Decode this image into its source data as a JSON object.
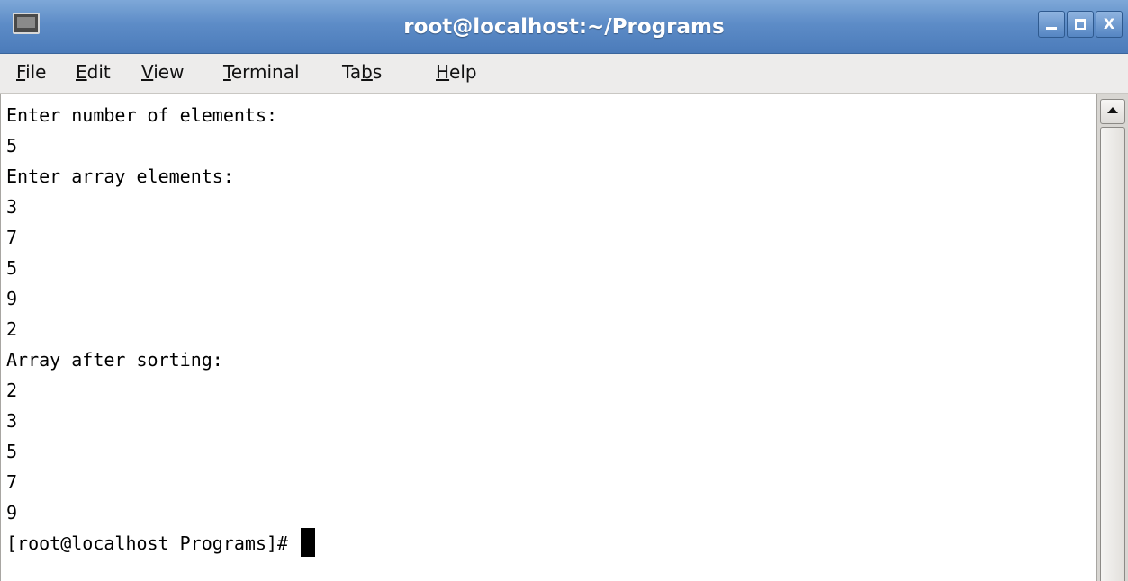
{
  "window": {
    "title": "root@localhost:~/Programs",
    "icon": "terminal-icon",
    "controls": {
      "minimize_icon": "minimize-icon",
      "maximize_icon": "maximize-icon",
      "close_icon": "close-icon",
      "close_label": "X"
    }
  },
  "menubar": {
    "items": [
      {
        "key": "F",
        "rest": "ile"
      },
      {
        "pre": "",
        "key": "E",
        "rest": "dit"
      },
      {
        "pre": "",
        "key": "V",
        "rest": "iew"
      },
      {
        "pre": "",
        "key": "T",
        "rest": "erminal"
      },
      {
        "pre": "Ta",
        "key": "b",
        "rest": "s"
      },
      {
        "pre": "",
        "key": "H",
        "rest": "elp"
      }
    ]
  },
  "terminal": {
    "lines": [
      "Enter number of elements:",
      "5",
      "Enter array elements:",
      "3",
      "7",
      "5",
      "9",
      "2",
      "Array after sorting:",
      "2",
      "3",
      "5",
      "7",
      "9"
    ],
    "prompt": "[root@localhost Programs]# "
  },
  "colors": {
    "titlebar": "#5d8cc7",
    "menubar": "#edeceb",
    "terminal_bg": "#ffffff",
    "terminal_fg": "#000000"
  }
}
